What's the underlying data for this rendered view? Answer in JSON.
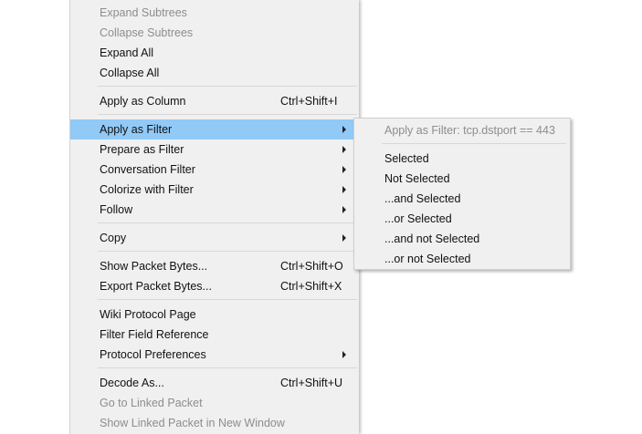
{
  "context_menu": {
    "items": [
      {
        "label": "Expand Subtrees",
        "shortcut": "",
        "disabled": true
      },
      {
        "label": "Collapse Subtrees",
        "shortcut": "",
        "disabled": true
      },
      {
        "label": "Expand All",
        "shortcut": ""
      },
      {
        "label": "Collapse All",
        "shortcut": ""
      },
      {
        "label": "Apply as Column",
        "shortcut": "Ctrl+Shift+I"
      },
      {
        "label": "Apply as Filter",
        "has_submenu": true,
        "highlighted": true
      },
      {
        "label": "Prepare as Filter",
        "has_submenu": true
      },
      {
        "label": "Conversation Filter",
        "has_submenu": true
      },
      {
        "label": "Colorize with Filter",
        "has_submenu": true
      },
      {
        "label": "Follow",
        "has_submenu": true
      },
      {
        "label": "Copy",
        "has_submenu": true
      },
      {
        "label": "Show Packet Bytes...",
        "shortcut": "Ctrl+Shift+O"
      },
      {
        "label": "Export Packet Bytes...",
        "shortcut": "Ctrl+Shift+X"
      },
      {
        "label": "Wiki Protocol Page"
      },
      {
        "label": "Filter Field Reference"
      },
      {
        "label": "Protocol Preferences",
        "has_submenu": true
      },
      {
        "label": "Decode As...",
        "shortcut": "Ctrl+Shift+U"
      },
      {
        "label": "Go to Linked Packet",
        "disabled": true
      },
      {
        "label": "Show Linked Packet in New Window",
        "disabled": true
      }
    ]
  },
  "submenu": {
    "header": "Apply as Filter: tcp.dstport == 443",
    "items": [
      {
        "label": "Selected"
      },
      {
        "label": "Not Selected"
      },
      {
        "label": "...and Selected"
      },
      {
        "label": "...or Selected"
      },
      {
        "label": "...and not Selected"
      },
      {
        "label": "...or not Selected"
      }
    ]
  },
  "colors": {
    "menu_background": "#f0f0f0",
    "highlight": "#91c9f7",
    "disabled_text": "#8d8d8d",
    "text": "#111111"
  }
}
